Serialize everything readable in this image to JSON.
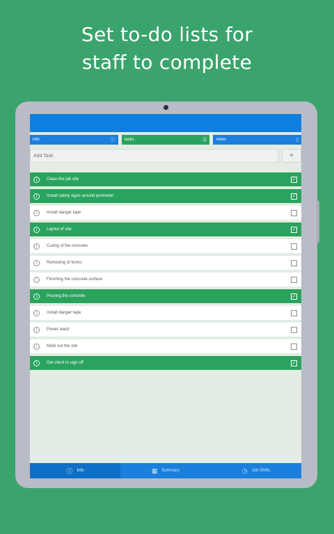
{
  "headline": {
    "line1": "Set to-do lists for",
    "line2": "staff to complete"
  },
  "tabs": [
    {
      "label": "info",
      "icon": "info-circle-icon",
      "glyph": "ⓘ"
    },
    {
      "label": "tasks",
      "icon": "list-icon",
      "glyph": "☰"
    },
    {
      "label": "notes",
      "icon": "clipboard-icon",
      "glyph": "▯"
    }
  ],
  "add_task": {
    "placeholder": "Add Task",
    "button": "+"
  },
  "tasks": [
    {
      "label": "Clean the job site",
      "done": true
    },
    {
      "label": "Install safety signs around perimeter",
      "done": true
    },
    {
      "label": "Install danger tape",
      "done": false
    },
    {
      "label": "Layout of site",
      "done": true
    },
    {
      "label": "Curing of the concrete",
      "done": false
    },
    {
      "label": "Removing of forms",
      "done": false
    },
    {
      "label": "Finishing the concrete surface",
      "done": false
    },
    {
      "label": "Pouring the concrete",
      "done": true
    },
    {
      "label": "Install danger tape",
      "done": false
    },
    {
      "label": "Power wash",
      "done": false
    },
    {
      "label": "Mark out the site",
      "done": false
    },
    {
      "label": "Get client to sign off",
      "done": true
    }
  ],
  "bottom_nav": [
    {
      "label": "Info",
      "icon": "info-icon",
      "glyph": "ⓘ",
      "active": true
    },
    {
      "label": "Summary",
      "icon": "summary-icon",
      "glyph": "▦",
      "active": false
    },
    {
      "label": "Job Shifts",
      "icon": "clock-icon",
      "glyph": "◷",
      "active": false
    }
  ],
  "colors": {
    "background": "#3ba46c",
    "accent_blue": "#1a7fdd",
    "done_green": "#2aa35e"
  }
}
